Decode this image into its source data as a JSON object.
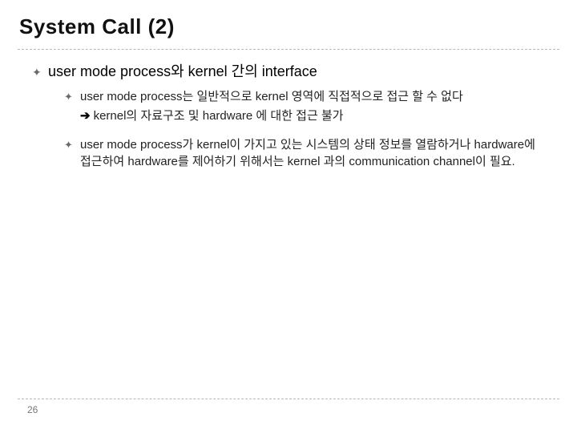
{
  "title": "System Call (2)",
  "main_bullet": "user mode process와 kernel 간의 interface",
  "sub": [
    {
      "line1": "user mode process는 일반적으로 kernel 영역에 직접적으로 접근 할 수 없다",
      "arrow_line": "kernel의 자료구조 및 hardware 에 대한 접근 불가"
    },
    {
      "line1": "user mode process가 kernel이 가지고 있는 시스템의 상태 정보를 열람하거나 hardware에 접근하여 hardware를 제어하기 위해서는 kernel 과의 communication channel이 필요."
    }
  ],
  "arrow_glyph": "➔",
  "page_number": "26"
}
